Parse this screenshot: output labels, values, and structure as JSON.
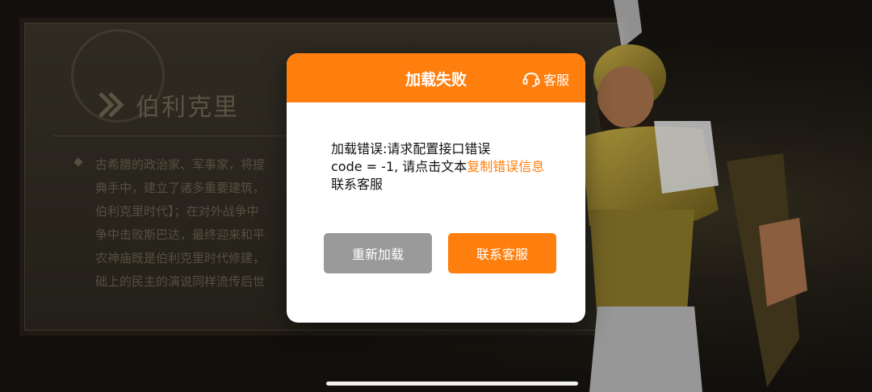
{
  "background": {
    "hero_name": "伯利克里",
    "description_lines": [
      "古希腊的政治家、军事家，将提",
      "典手中，建立了诸多重要建筑，",
      "伯利克里时代】；在对外战争中",
      "争中击败斯巴达，最终迎来和平",
      "农神庙既是伯利克里时代修建，",
      "础上的民主的演说同样流传后世"
    ]
  },
  "dialog": {
    "title": "加载失败",
    "support_label": "客服",
    "support_icon": "headset-icon",
    "message_part1": "加载错误:请求配置接口错误",
    "message_part2": "code = -1,  请点击文本",
    "message_link": "复制错误信息",
    "message_part3": "联系客服",
    "retry_label": "重新加载",
    "contact_label": "联系客服"
  },
  "colors": {
    "accent": "#ff7f0e",
    "retry_button": "#9a9a9a"
  }
}
